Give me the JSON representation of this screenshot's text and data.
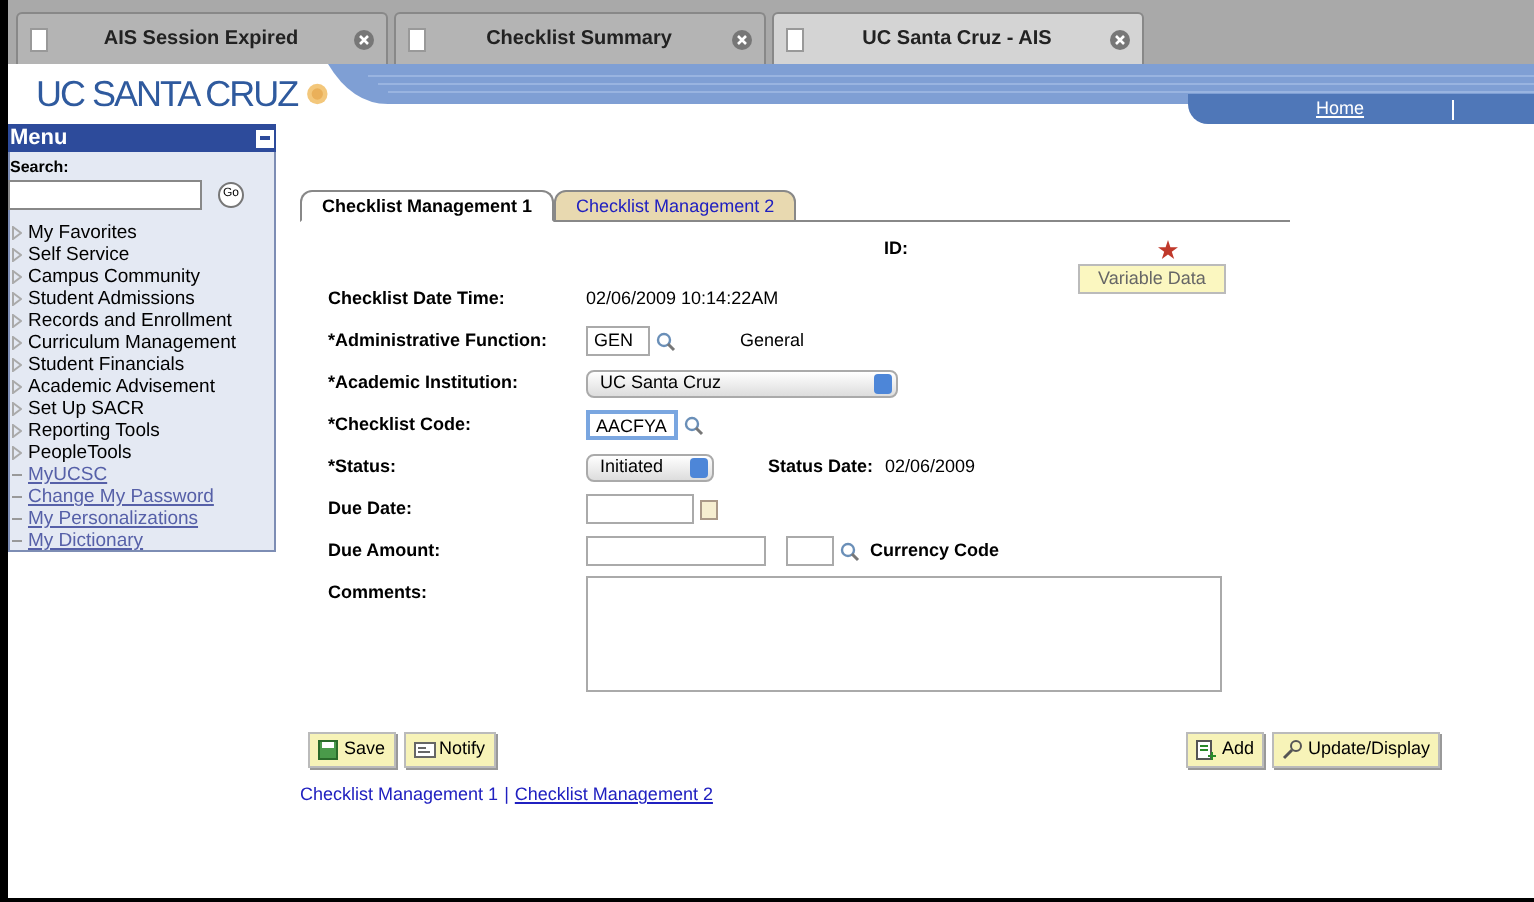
{
  "browser_tabs": [
    {
      "label": "AIS Session Expired",
      "selected": false
    },
    {
      "label": "Checklist Summary",
      "selected": false
    },
    {
      "label": "UC Santa Cruz - AIS",
      "selected": true
    }
  ],
  "header": {
    "logo_text": "UC SANTA CRUZ",
    "nav_links": [
      "Home"
    ]
  },
  "menu": {
    "title": "Menu",
    "search_label": "Search:",
    "go_button": "Go",
    "items": [
      {
        "label": "My Favorites",
        "kind": "folder"
      },
      {
        "label": "Self Service",
        "kind": "folder"
      },
      {
        "label": "Campus Community",
        "kind": "folder"
      },
      {
        "label": "Student Admissions",
        "kind": "folder"
      },
      {
        "label": "Records and Enrollment",
        "kind": "folder"
      },
      {
        "label": "Curriculum Management",
        "kind": "folder"
      },
      {
        "label": "Student Financials",
        "kind": "folder"
      },
      {
        "label": "Academic Advisement",
        "kind": "folder"
      },
      {
        "label": "Set Up SACR",
        "kind": "folder"
      },
      {
        "label": "Reporting Tools",
        "kind": "folder"
      },
      {
        "label": "PeopleTools",
        "kind": "folder"
      },
      {
        "label": "MyUCSC",
        "kind": "link"
      },
      {
        "label": "Change My Password",
        "kind": "link"
      },
      {
        "label": "My Personalizations",
        "kind": "link"
      },
      {
        "label": "My Dictionary",
        "kind": "link"
      }
    ]
  },
  "page_tabs": [
    {
      "label": "Checklist Management 1",
      "selected": true
    },
    {
      "label": "Checklist Management 2",
      "selected": false
    }
  ],
  "id_label": "ID:",
  "variable_data_button": "Variable Data",
  "fields": [
    {
      "kind": "text",
      "label": "Checklist Date Time:",
      "value": "02/06/2009 10:14:22AM"
    },
    {
      "kind": "lookup",
      "label": "*Administrative Function:",
      "value": "GEN",
      "description": "General",
      "focused": false
    },
    {
      "kind": "select",
      "label": "*Academic Institution:",
      "value": "UC Santa Cruz"
    },
    {
      "kind": "lookup",
      "label": "*Checklist Code:",
      "value": "AACFYA",
      "focused": true
    },
    {
      "kind": "status",
      "label": "*Status:",
      "value": "Initiated",
      "extra_label": "Status Date:",
      "extra_value": "02/06/2009"
    },
    {
      "kind": "date",
      "label": "Due Date:"
    },
    {
      "kind": "amount",
      "label": "Due Amount:",
      "extra_label": "Currency Code"
    },
    {
      "kind": "textarea",
      "label": "Comments:"
    }
  ],
  "left_buttons": [
    {
      "label": "Save",
      "kind": "save"
    },
    {
      "label": "Notify",
      "kind": "notify"
    }
  ],
  "right_buttons": [
    {
      "label": "Add",
      "kind": "add"
    },
    {
      "label": "Update/Display",
      "kind": "update"
    }
  ],
  "footer_links": [
    {
      "label": "Checklist Management 1",
      "selected": true
    },
    {
      "label": "Checklist Management 2",
      "selected": false
    }
  ],
  "footer_separator": "|"
}
